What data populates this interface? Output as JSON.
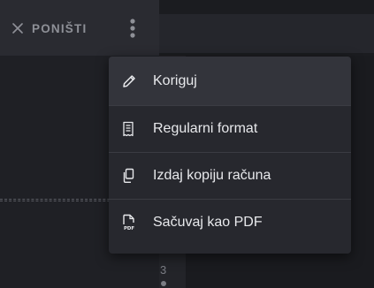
{
  "toolbar": {
    "cancel_label": "PONIŠTI",
    "cancel_icon": "close-icon",
    "more_icon": "more-vertical-icon"
  },
  "background": {
    "partial_digit": "3"
  },
  "menu": {
    "items": [
      {
        "label": "Koriguj",
        "icon": "pencil-icon"
      },
      {
        "label": "Regularni format",
        "icon": "receipt-icon"
      },
      {
        "label": "Izdaj kopiju računa",
        "icon": "copy-icon"
      },
      {
        "label": "Sačuvaj kao PDF",
        "icon": "pdf-file-icon"
      }
    ]
  },
  "colors": {
    "menu_bg": "#27282e",
    "menu_highlight": "#33343b",
    "text": "#e8e9ec",
    "muted": "#8e9097"
  }
}
